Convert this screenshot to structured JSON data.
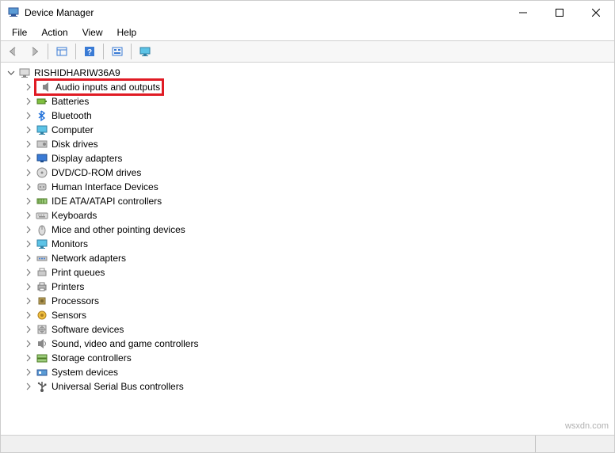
{
  "window": {
    "title": "Device Manager"
  },
  "menubar": {
    "items": [
      "File",
      "Action",
      "View",
      "Help"
    ]
  },
  "tree": {
    "root": {
      "label": "RISHIDHARIW36A9",
      "expanded": true
    },
    "nodes": [
      {
        "label": "Audio inputs and outputs",
        "icon": "audio",
        "highlighted": true
      },
      {
        "label": "Batteries",
        "icon": "battery"
      },
      {
        "label": "Bluetooth",
        "icon": "bluetooth"
      },
      {
        "label": "Computer",
        "icon": "computer"
      },
      {
        "label": "Disk drives",
        "icon": "disk"
      },
      {
        "label": "Display adapters",
        "icon": "display"
      },
      {
        "label": "DVD/CD-ROM drives",
        "icon": "cdrom"
      },
      {
        "label": "Human Interface Devices",
        "icon": "hid"
      },
      {
        "label": "IDE ATA/ATAPI controllers",
        "icon": "ide"
      },
      {
        "label": "Keyboards",
        "icon": "keyboard"
      },
      {
        "label": "Mice and other pointing devices",
        "icon": "mouse"
      },
      {
        "label": "Monitors",
        "icon": "monitor"
      },
      {
        "label": "Network adapters",
        "icon": "network"
      },
      {
        "label": "Print queues",
        "icon": "printq"
      },
      {
        "label": "Printers",
        "icon": "printer"
      },
      {
        "label": "Processors",
        "icon": "cpu"
      },
      {
        "label": "Sensors",
        "icon": "sensor"
      },
      {
        "label": "Software devices",
        "icon": "software"
      },
      {
        "label": "Sound, video and game controllers",
        "icon": "sound"
      },
      {
        "label": "Storage controllers",
        "icon": "storage"
      },
      {
        "label": "System devices",
        "icon": "system"
      },
      {
        "label": "Universal Serial Bus controllers",
        "icon": "usb"
      }
    ]
  },
  "watermark": "wsxdn.com"
}
